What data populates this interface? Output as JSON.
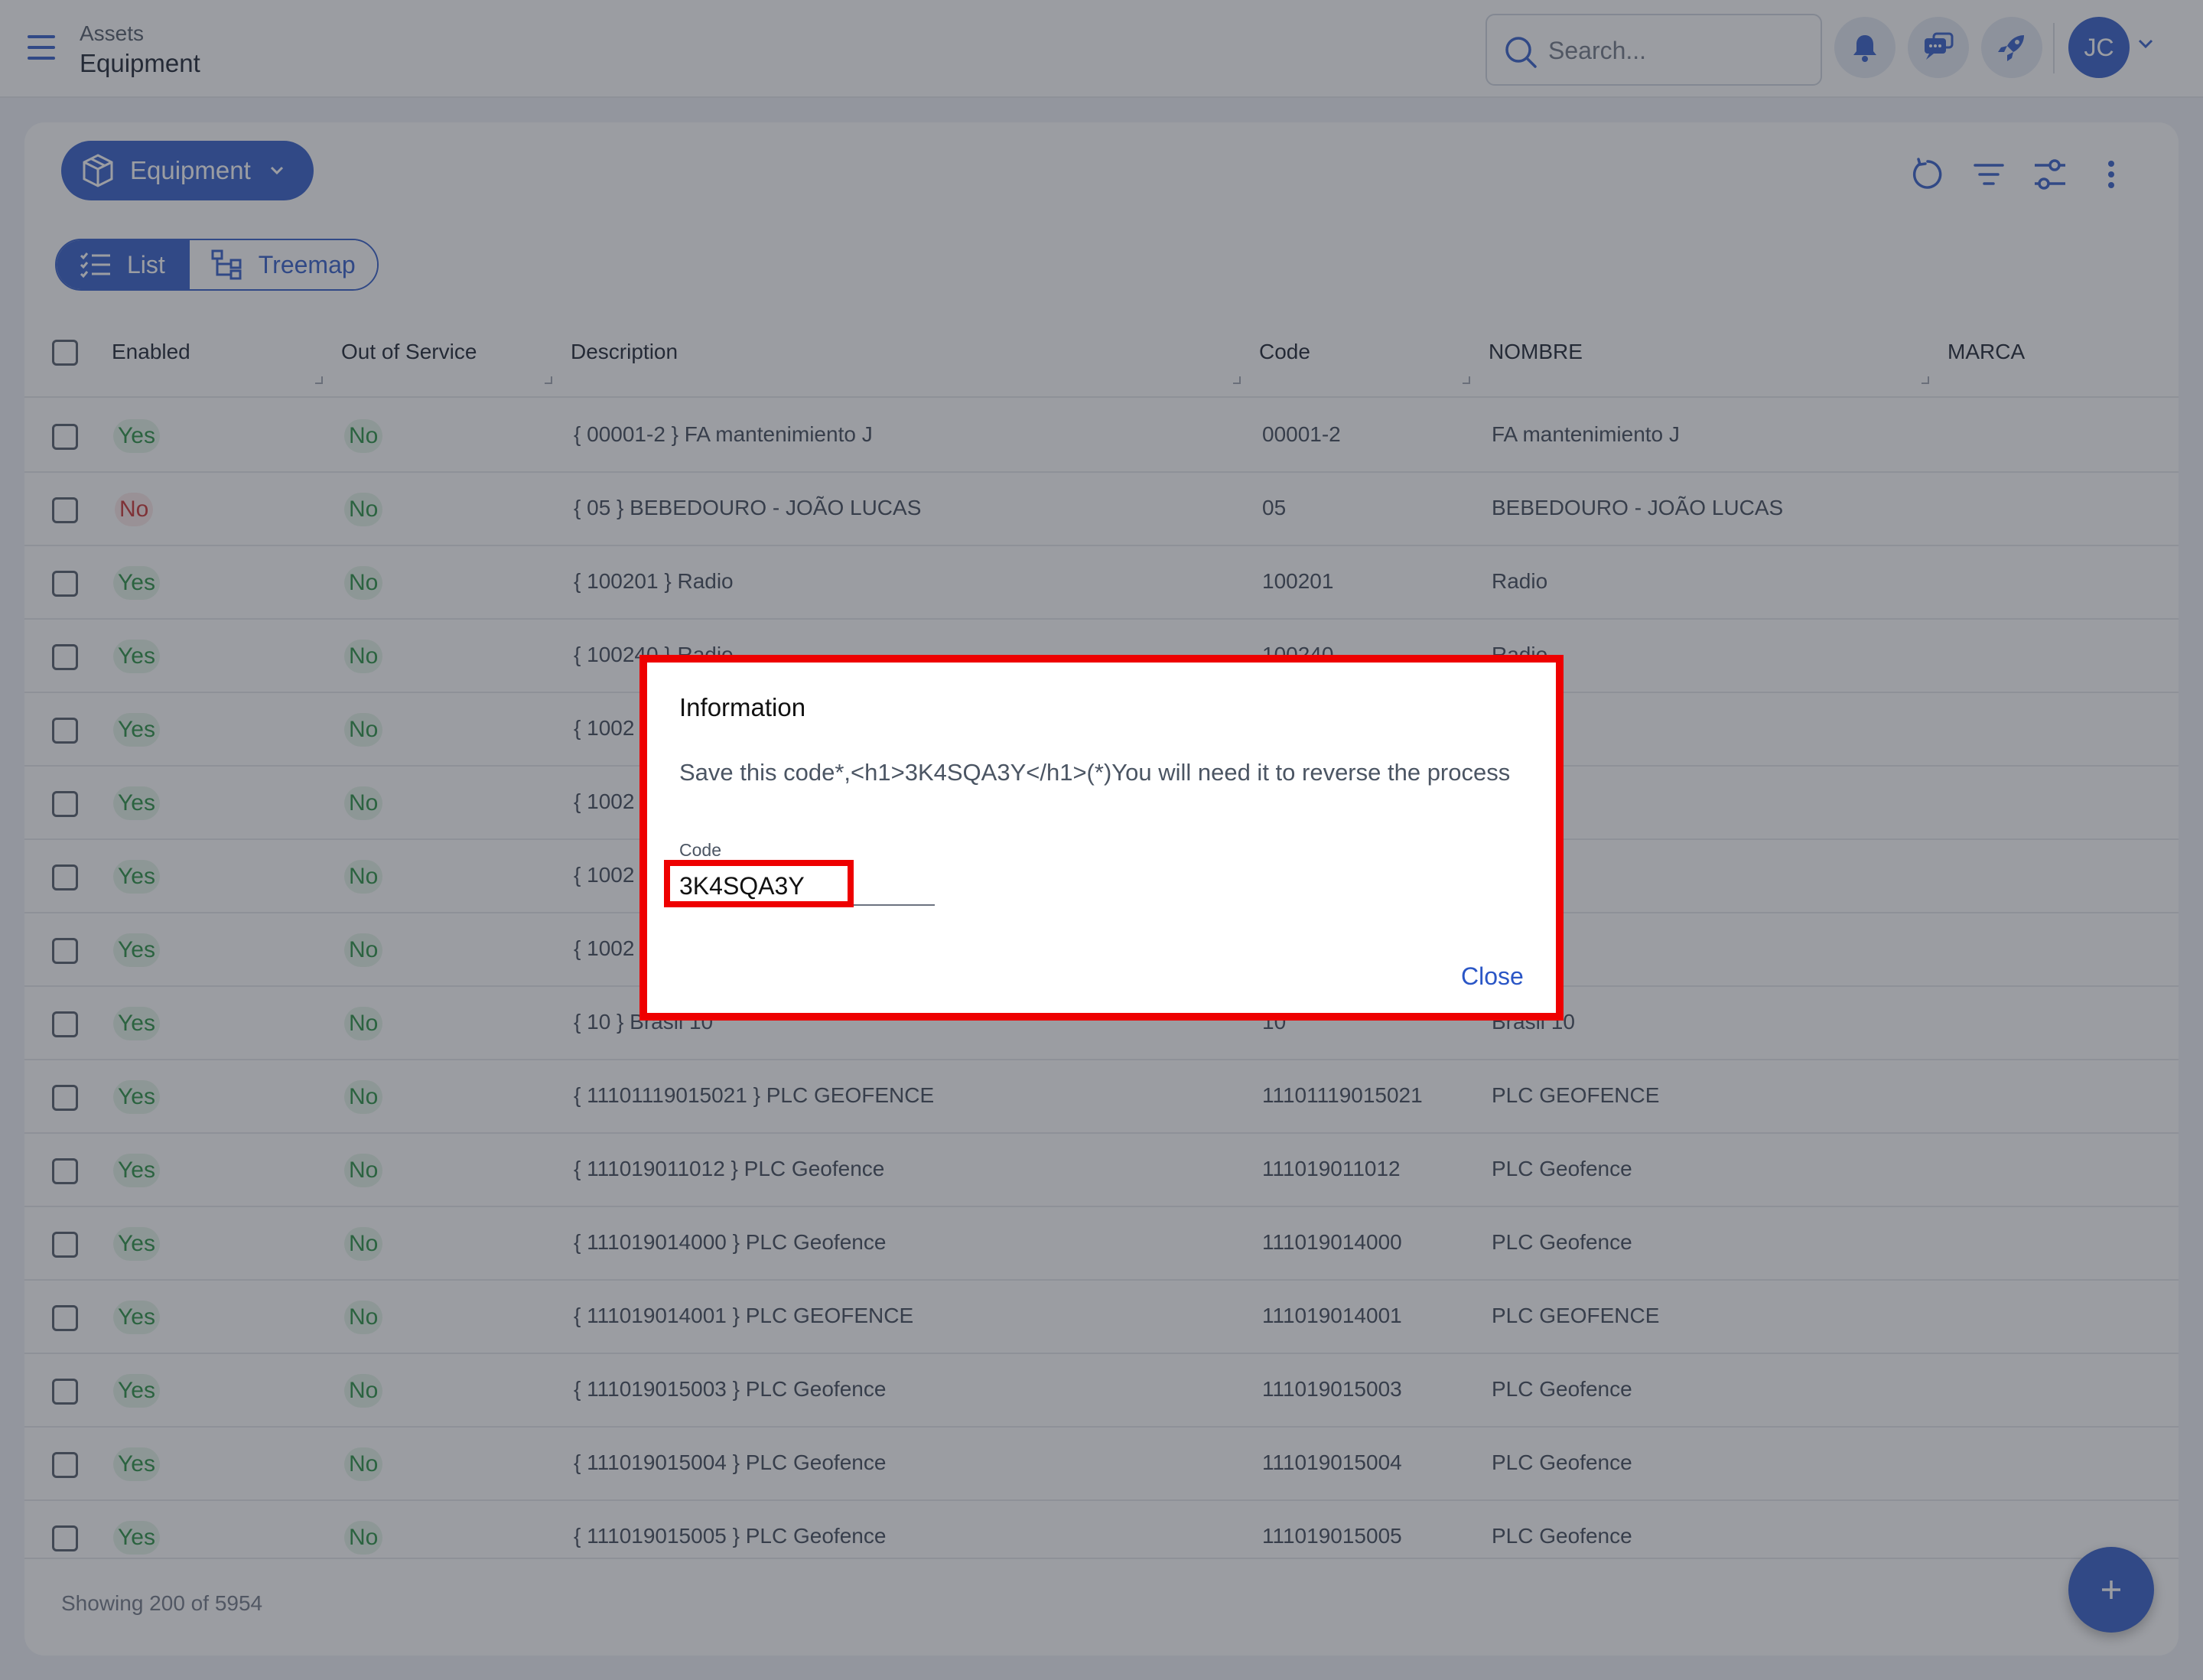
{
  "header": {
    "breadcrumb_parent": "Assets",
    "breadcrumb_current": "Equipment",
    "search_placeholder": "Search...",
    "user_initials": "JC"
  },
  "toolbar": {
    "entity_button_label": "Equipment"
  },
  "view_toggle": {
    "list_label": "List",
    "treemap_label": "Treemap",
    "active": "List"
  },
  "table": {
    "columns": [
      "Enabled",
      "Out of Service",
      "Description",
      "Code",
      "NOMBRE",
      "MARCA"
    ],
    "rows": [
      {
        "enabled": "Yes",
        "out_of_service": "No",
        "description": "{ 00001-2 } FA mantenimiento J",
        "code": "00001-2",
        "nombre": "FA mantenimiento J"
      },
      {
        "enabled": "No",
        "out_of_service": "No",
        "description": "{ 05 } BEBEDOURO - JOÃO LUCAS",
        "code": "05",
        "nombre": "BEBEDOURO - JOÃO LUCAS"
      },
      {
        "enabled": "Yes",
        "out_of_service": "No",
        "description": "{ 100201 } Radio",
        "code": "100201",
        "nombre": "Radio"
      },
      {
        "enabled": "Yes",
        "out_of_service": "No",
        "description": "{ 100240 } Radio",
        "code": "100240",
        "nombre": "Radio"
      },
      {
        "enabled": "Yes",
        "out_of_service": "No",
        "description": "{ 1002",
        "code": "",
        "nombre": ""
      },
      {
        "enabled": "Yes",
        "out_of_service": "No",
        "description": "{ 1002",
        "code": "",
        "nombre": ""
      },
      {
        "enabled": "Yes",
        "out_of_service": "No",
        "description": "{ 1002",
        "code": "",
        "nombre": ""
      },
      {
        "enabled": "Yes",
        "out_of_service": "No",
        "description": "{ 1002",
        "code": "",
        "nombre": ""
      },
      {
        "enabled": "Yes",
        "out_of_service": "No",
        "description": "{ 10 } Brasil 10",
        "code": "10",
        "nombre": "Brasil 10"
      },
      {
        "enabled": "Yes",
        "out_of_service": "No",
        "description": "{ 11101119015021 } PLC GEOFENCE",
        "code": "11101119015021",
        "nombre": "PLC GEOFENCE"
      },
      {
        "enabled": "Yes",
        "out_of_service": "No",
        "description": "{ 111019011012 } PLC Geofence",
        "code": "111019011012",
        "nombre": "PLC Geofence"
      },
      {
        "enabled": "Yes",
        "out_of_service": "No",
        "description": "{ 111019014000 } PLC Geofence",
        "code": "111019014000",
        "nombre": "PLC Geofence"
      },
      {
        "enabled": "Yes",
        "out_of_service": "No",
        "description": "{ 111019014001 } PLC GEOFENCE",
        "code": "111019014001",
        "nombre": "PLC GEOFENCE"
      },
      {
        "enabled": "Yes",
        "out_of_service": "No",
        "description": "{ 111019015003 } PLC Geofence",
        "code": "111019015003",
        "nombre": "PLC Geofence"
      },
      {
        "enabled": "Yes",
        "out_of_service": "No",
        "description": "{ 111019015004 } PLC Geofence",
        "code": "111019015004",
        "nombre": "PLC Geofence"
      },
      {
        "enabled": "Yes",
        "out_of_service": "No",
        "description": "{ 111019015005 } PLC Geofence",
        "code": "111019015005",
        "nombre": "PLC Geofence"
      }
    ]
  },
  "footer": {
    "showing_text": "Showing 200 of 5954"
  },
  "dialog": {
    "title": "Information",
    "message": "Save this code*,<h1>3K4SQA3Y</h1>(*)You will need it to reverse the process",
    "field_label": "Code",
    "field_value": "3K4SQA3Y",
    "close_label": "Close"
  },
  "colors": {
    "primary": "#2a56c6",
    "yes_text": "#1f8a3a",
    "no_text": "#c62828",
    "highlight_border": "#ee0000"
  }
}
